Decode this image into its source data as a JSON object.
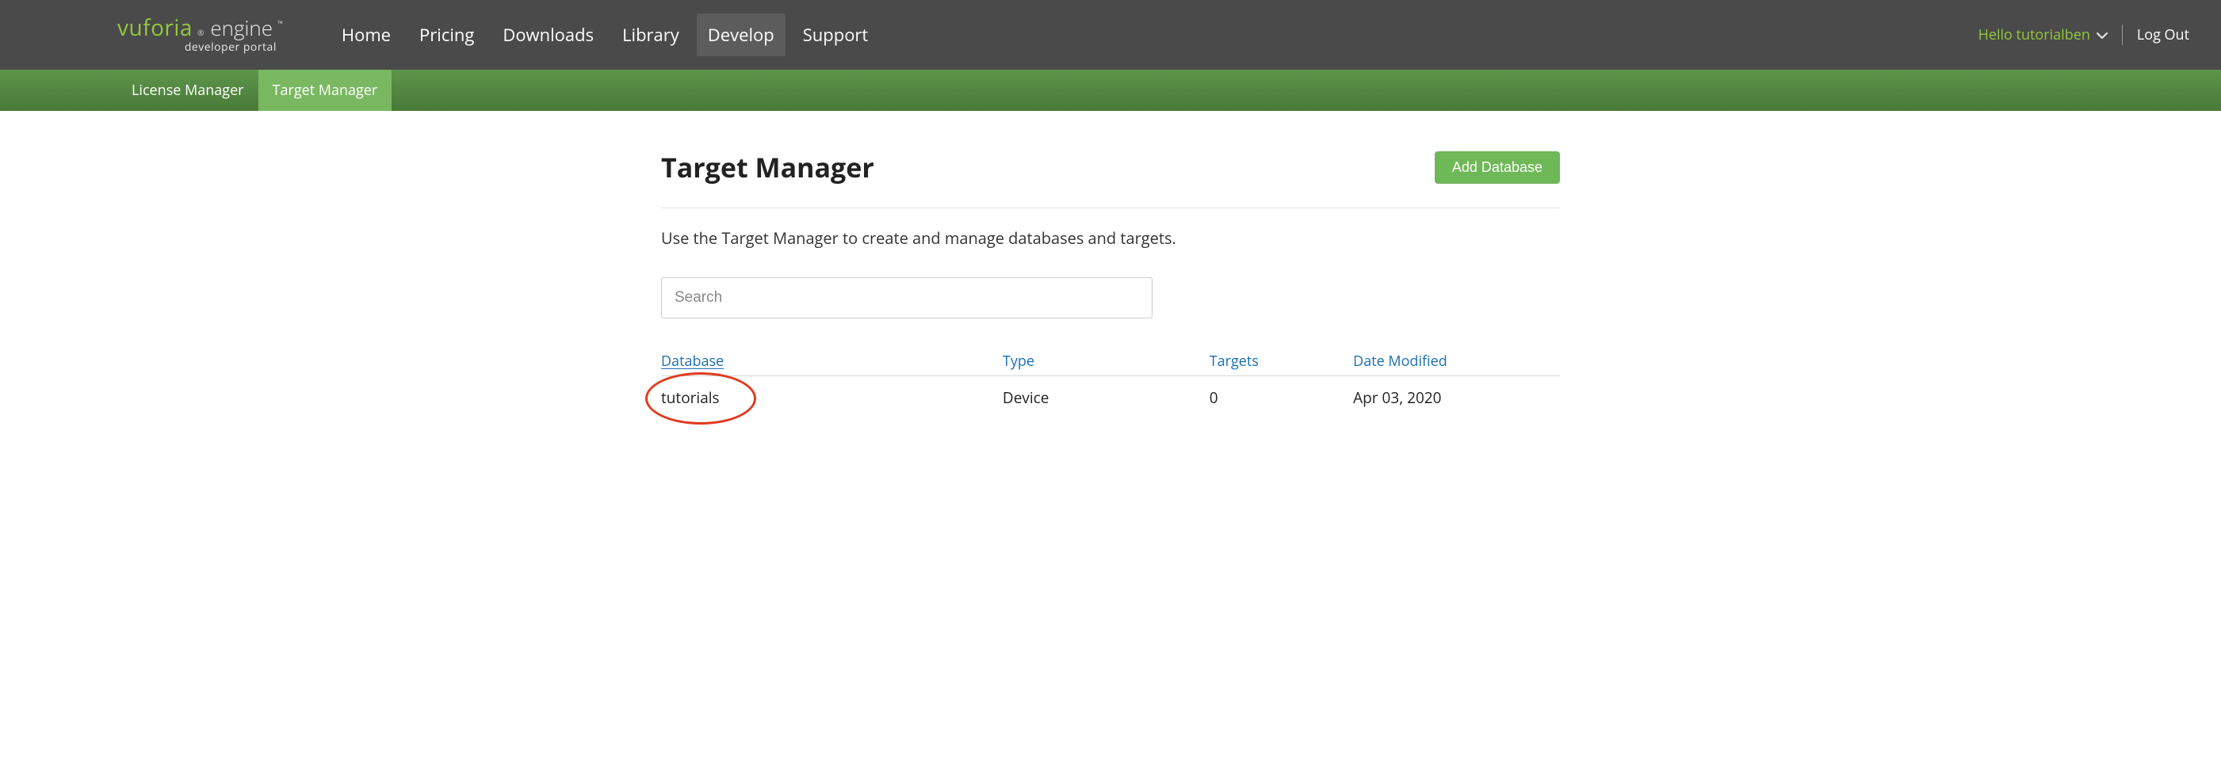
{
  "brand": {
    "name": "vuforia",
    "product": "engine",
    "subtitle": "developer portal"
  },
  "nav": {
    "items": [
      {
        "label": "Home"
      },
      {
        "label": "Pricing"
      },
      {
        "label": "Downloads"
      },
      {
        "label": "Library"
      },
      {
        "label": "Develop",
        "active": true
      },
      {
        "label": "Support"
      }
    ]
  },
  "user": {
    "greeting": "Hello tutorialben",
    "logout": "Log Out"
  },
  "subnav": {
    "items": [
      {
        "label": "License Manager"
      },
      {
        "label": "Target Manager",
        "active": true
      }
    ]
  },
  "page": {
    "title": "Target Manager",
    "add_button": "Add Database",
    "description": "Use the Target Manager to create and manage databases and targets.",
    "search_placeholder": "Search"
  },
  "table": {
    "columns": {
      "database": "Database",
      "type": "Type",
      "targets": "Targets",
      "date_modified": "Date Modified"
    },
    "rows": [
      {
        "database": "tutorials",
        "type": "Device",
        "targets": "0",
        "date_modified": "Apr 03, 2020"
      }
    ]
  }
}
